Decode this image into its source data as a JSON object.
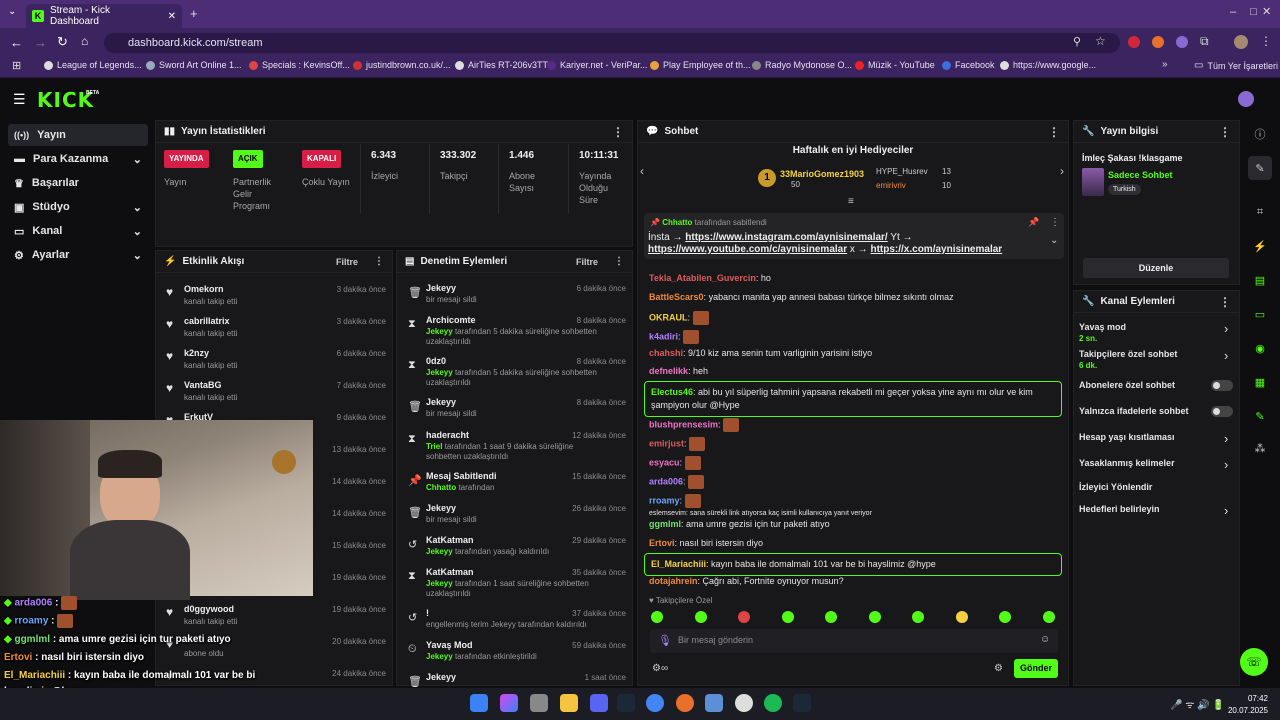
{
  "browser": {
    "tab_title": "Stream - Kick Dashboard",
    "url": "dashboard.kick.com/stream",
    "bookmarks": [
      "League of Legends...",
      "Sword Art Online 1...",
      "Specials : KevinsOff...",
      "justindbrown.co.uk/...",
      "AirTies RT-206v3TT",
      "Kariyer.net - VeriPar...",
      "Play Employee of th...",
      "Radyo Mydonose O...",
      "Müzik - YouTube",
      "Facebook",
      "https://www.google..."
    ],
    "bookmarks_other": "Tüm Yer İşaretleri"
  },
  "brand": {
    "logo": "KICK",
    "beta": "BETA",
    "accent": "#53fc18"
  },
  "sidebar": {
    "items": [
      "Yayın",
      "Para Kazanma",
      "Başarılar",
      "Stüdyo",
      "Kanal",
      "Ayarlar"
    ]
  },
  "stats": {
    "title": "Yayın İstatistikleri",
    "cells": [
      {
        "badge": "YAYINDA",
        "label": "Yayın"
      },
      {
        "badge": "AÇIK",
        "label": "Partnerlik Gelir Programı"
      },
      {
        "badge": "KAPALI",
        "label": "Çoklu Yayın"
      },
      {
        "value": "6.343",
        "label": "İzleyici"
      },
      {
        "value": "333.302",
        "label": "Takipçi"
      },
      {
        "value": "1.446",
        "label": "Abone Sayısı"
      },
      {
        "value": "10:11:31",
        "label": "Yayında Olduğu Süre"
      }
    ]
  },
  "activity": {
    "title": "Etkinlik Akışı",
    "filter": "Filtre",
    "rows": [
      {
        "name": "Omekorn",
        "sub": "kanalı takip etti",
        "time": "3 dakika önce"
      },
      {
        "name": "cabrillatrix",
        "sub": "kanalı takip etti",
        "time": "3 dakika önce"
      },
      {
        "name": "k2nzy",
        "sub": "kanalı takip etti",
        "time": "6 dakika önce"
      },
      {
        "name": "VantaBG",
        "sub": "kanalı takip etti",
        "time": "7 dakika önce"
      },
      {
        "name": "ErkutV",
        "sub": "",
        "time": "9 dakika önce"
      },
      {
        "name": "",
        "sub": "",
        "time": "13 dakika önce"
      },
      {
        "name": "",
        "sub": "",
        "time": "14 dakika önce"
      },
      {
        "name": "",
        "sub": "",
        "time": "14 dakika önce"
      },
      {
        "name": "",
        "sub": "",
        "time": "15 dakika önce"
      },
      {
        "name": "",
        "sub": "",
        "time": "19 dakika önce"
      },
      {
        "name": "d0ggywood",
        "sub": "kanalı takip etti",
        "time": "19 dakika önce"
      },
      {
        "name": "",
        "sub": "abone oldu",
        "time": "20 dakika önce"
      },
      {
        "name": "",
        "sub": "",
        "time": "24 dakika önce"
      }
    ]
  },
  "moderation": {
    "title": "Denetim Eylemleri",
    "filter": "Filtre",
    "rows": [
      {
        "name": "Jekeyy",
        "sub": "bir mesajı sildi",
        "time": "6 dakika önce",
        "icon": "trash-icon"
      },
      {
        "name": "Archicomte",
        "actor": "Jekeyy",
        "sub": "tarafından 5 dakika süreliğine sohbetten uzaklaştırıldı",
        "time": "8 dakika önce",
        "icon": "hourglass-icon"
      },
      {
        "name": "0dz0",
        "actor": "Jekeyy",
        "sub": "tarafından 5 dakika süreliğine sohbetten uzaklaştırıldı",
        "time": "8 dakika önce",
        "icon": "hourglass-icon"
      },
      {
        "name": "Jekeyy",
        "sub": "bir mesajı sildi",
        "time": "8 dakika önce",
        "icon": "trash-icon"
      },
      {
        "name": "haderacht",
        "actor": "Triel",
        "sub": "tarafından 1 saat 9 dakika süreliğine sohbetten uzaklaştırıldı",
        "time": "12 dakika önce",
        "icon": "hourglass-icon"
      },
      {
        "name": "Mesaj Sabitlendi",
        "actor": "Chhatto",
        "sub": "tarafından",
        "time": "15 dakika önce",
        "icon": "pin-icon"
      },
      {
        "name": "Jekeyy",
        "sub": "bir mesajı sildi",
        "time": "26 dakika önce",
        "icon": "trash-icon"
      },
      {
        "name": "KatKatman",
        "actor": "Jekeyy",
        "sub": "tarafından yasağı kaldırıldı",
        "time": "29 dakika önce",
        "icon": "undo-icon"
      },
      {
        "name": "KatKatman",
        "actor": "Jekeyy",
        "sub": "tarafından 1 saat süreliğine sohbetten uzaklaştırıldı",
        "time": "35 dakika önce",
        "icon": "hourglass-icon"
      },
      {
        "name": "!",
        "sub": "engellenmiş terim Jekeyy tarafından kaldırıldı",
        "time": "37 dakika önce",
        "icon": "undo-icon"
      },
      {
        "name": "Yavaş Mod",
        "actor": "Jekeyy",
        "sub": "tarafından etkinleştirildi",
        "time": "59 dakika önce",
        "icon": "slow-icon"
      },
      {
        "name": "Jekeyy",
        "sub": "",
        "time": "1 saat önce",
        "icon": "trash-icon"
      }
    ]
  },
  "chat": {
    "title": "Sohbet",
    "gifters_title": "Haftalık en iyi Hediyeciler",
    "gifters": [
      {
        "rank": "1",
        "name": "33MarioGomez1903",
        "count": "50"
      },
      {
        "name": "HYPE_Husrev",
        "count": "13"
      },
      {
        "name": "emirivriv",
        "count": "10"
      }
    ],
    "pinned": {
      "by": "Chhatto",
      "label": "tarafından sabitlendi",
      "text1": "İnsta → ",
      "link1": "https://www.instagram.com/aynisinemalar/",
      "text2": " Yt →",
      "link2": "https://www.youtube.com/c/aynisinemalar",
      "text3": " x → ",
      "link3": "https://x.com/aynisinemalar"
    },
    "messages": [
      {
        "user": "Tekla_Atabilen_Guvercin",
        "color": "#e05a5a",
        "text": "ho"
      },
      {
        "user": "BattleScars0",
        "color": "#f08a3c",
        "text": "yabancı manita yap annesi babası türkçe bilmez sıkıntı olmaz"
      },
      {
        "user": "OKRAUL",
        "color": "#f5d142",
        "text": ""
      },
      {
        "user": "k4adiri",
        "color": "#b080ff",
        "text": ""
      },
      {
        "user": "chahshi",
        "color": "#e05a5a",
        "text": "9/10 kiz ama senin tum varliginin yarisini istiyo"
      },
      {
        "user": "defnelikk",
        "color": "#f072c6",
        "text": "heh"
      },
      {
        "user": "Electus46",
        "color": "#53fc18",
        "text": "abi bu yıl süperlig tahmini yapsana rekabetli mi geçer yoksa yine aynı mı olur ve kim şampiyon olur @Hype"
      },
      {
        "user": "blushprensesim",
        "color": "#f072c6",
        "text": ""
      },
      {
        "user": "emirjust",
        "color": "#e05a5a",
        "text": ""
      },
      {
        "user": "esyacu",
        "color": "#f072c6",
        "text": ""
      },
      {
        "user": "arda006",
        "color": "#b080ff",
        "text": ""
      },
      {
        "user": "rroamy",
        "color": "#6aa6ff",
        "text": ""
      },
      {
        "user": "",
        "color": "#9a9a9a",
        "text": "eslemsevim: sana sürekli link atıyorsa kaç isimli kullanıcıya yanıt veriyor"
      },
      {
        "user": "ggmlml",
        "color": "#6ee36e",
        "text": "ama umre gezisi için tur paketi atıyo"
      },
      {
        "user": "Ertovi",
        "color": "#f08a3c",
        "text": "nasıl biri istersin diyo"
      },
      {
        "user": "El_Mariachiii",
        "color": "#f5d142",
        "text": "kayın baba ile domalmalı 101 var be bi hayslimiz @hype"
      },
      {
        "user": "dotajahrein",
        "color": "#f08a3c",
        "text": "Çağrı abi, Fortnite oynuyor musun?"
      }
    ],
    "followers_only": "Takipçilere Özel",
    "placeholder": "Bir mesaj gönderin",
    "send": "Gönder"
  },
  "stream_info": {
    "title": "Yayın bilgisi",
    "stream_title": "İmleç Şakası !klasgame",
    "category": "Sadece Sohbet",
    "tag": "Turkish",
    "edit": "Düzenle"
  },
  "channel_actions": {
    "title": "Kanal Eylemleri",
    "items": [
      {
        "label": "Yavaş mod",
        "sub": "2 sn."
      },
      {
        "label": "Takipçilere özel sohbet",
        "sub": "6 dk."
      },
      {
        "label": "Abonelere özel sohbet",
        "sub": ""
      },
      {
        "label": "Yalnızca ifadelerle sohbet",
        "sub": ""
      },
      {
        "label": "Hesap yaşı kısıtlaması",
        "sub": ""
      },
      {
        "label": "Yasaklanmış kelimeler",
        "sub": ""
      },
      {
        "label": "İzleyici Yönlendir",
        "sub": ""
      },
      {
        "label": "Hedefleri belirleyin",
        "sub": ""
      }
    ]
  },
  "overlay_chat": [
    {
      "user": "arda006",
      "color": "#b080ff",
      "text": ":"
    },
    {
      "user": "rroamy",
      "color": "#6aa6ff",
      "text": ":"
    },
    {
      "user": "ggmlml",
      "color": "#6ee36e",
      "text": ": ama umre gezisi için tur paketi atıyo"
    },
    {
      "user": "Ertovi",
      "color": "#f08a3c",
      "text": ": nasıl biri istersin diyo"
    },
    {
      "user": "El_Mariachiii",
      "color": "#f5d142",
      "text": ": kayın baba ile domalmalı 101 var be bi"
    },
    {
      "user": "",
      "color": "#ffffff",
      "text": "hayslimiz @hype"
    },
    {
      "user": "dotajahrein",
      "color": "#f08a3c",
      "text": ": Çağrı abi, Fortnite oynuyor musun?"
    }
  ],
  "taskbar": {
    "time": "07:42",
    "date": "20.07.2025"
  }
}
